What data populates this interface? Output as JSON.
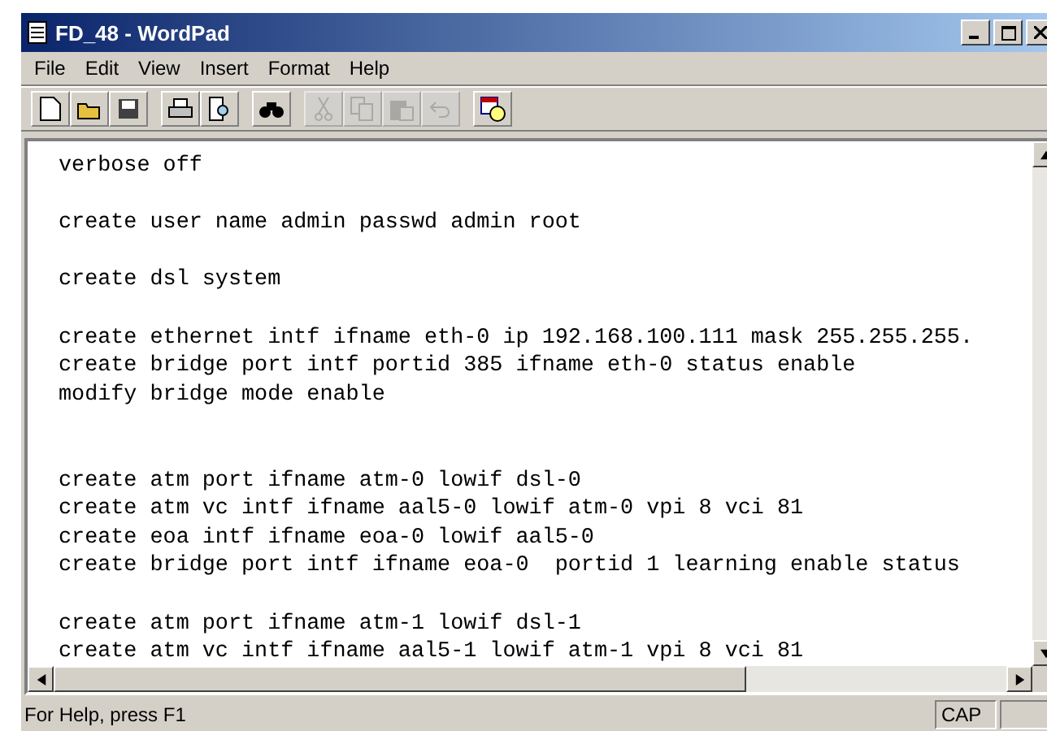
{
  "window": {
    "title": "FD_48 - WordPad"
  },
  "menu": [
    "File",
    "Edit",
    "View",
    "Insert",
    "Format",
    "Help"
  ],
  "toolbar": {
    "groups": [
      {
        "buttons": [
          {
            "kind": "new",
            "disabled": false
          },
          {
            "kind": "open",
            "disabled": false
          },
          {
            "kind": "save",
            "disabled": false
          }
        ]
      },
      {
        "buttons": [
          {
            "kind": "print",
            "disabled": false
          },
          {
            "kind": "preview",
            "disabled": false
          }
        ]
      },
      {
        "buttons": [
          {
            "kind": "find",
            "disabled": false
          }
        ]
      },
      {
        "buttons": [
          {
            "kind": "cut",
            "disabled": true
          },
          {
            "kind": "copy",
            "disabled": true
          },
          {
            "kind": "paste",
            "disabled": true
          },
          {
            "kind": "undo",
            "disabled": true
          }
        ]
      },
      {
        "buttons": [
          {
            "kind": "datetime",
            "disabled": false
          }
        ]
      }
    ]
  },
  "document": {
    "blocks": [
      {
        "kind": "single",
        "lines": [
          "verbose off"
        ]
      },
      {
        "kind": "single",
        "lines": [
          "create user name admin passwd admin root"
        ]
      },
      {
        "kind": "single",
        "lines": [
          "create dsl system"
        ]
      },
      {
        "kind": "single",
        "lines": [
          "create ethernet intf ifname eth-0 ip 192.168.100.111 mask 255.255.255.",
          "create bridge port intf portid 385 ifname eth-0 status enable",
          "modify bridge mode enable"
        ]
      },
      {
        "kind": "double",
        "lines": [
          "create atm port ifname atm-0 lowif dsl-0",
          "create atm vc intf ifname aal5-0 lowif atm-0 vpi 8 vci 81",
          "create eoa intf ifname eoa-0 lowif aal5-0",
          "create bridge port intf ifname eoa-0  portid 1 learning enable status"
        ]
      },
      {
        "kind": "single",
        "lines": [
          "create atm port ifname atm-1 lowif dsl-1",
          "create atm vc intf ifname aal5-1 lowif atm-1 vpi 8 vci 81"
        ]
      }
    ]
  },
  "status_bar": {
    "text": "For Help, press F1",
    "indicators": [
      {
        "label": "CAP"
      }
    ]
  }
}
